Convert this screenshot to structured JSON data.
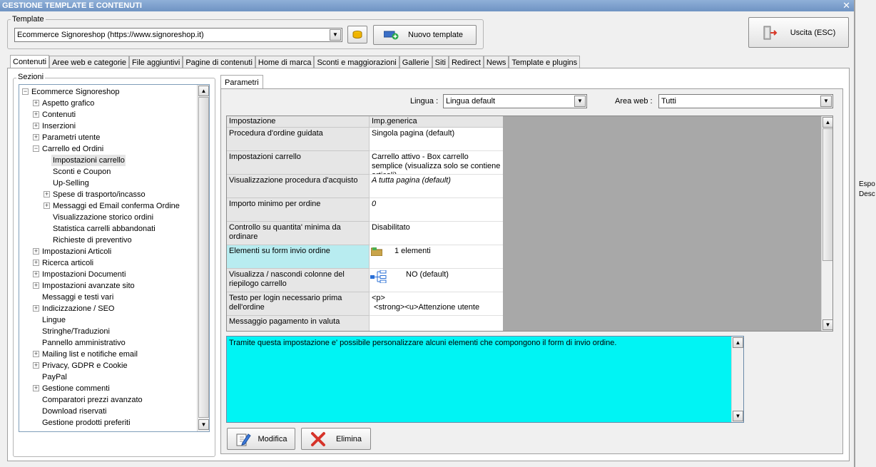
{
  "window": {
    "title": "GESTIONE TEMPLATE E CONTENUTI",
    "close_glyph": "✕"
  },
  "outside_text": {
    "line1": "Espo",
    "line2": "Desc"
  },
  "template": {
    "group_label": "Template",
    "selected": "Ecommerce Signoreshop (https://www.signoreshop.it)",
    "new_button": "Nuovo template"
  },
  "exit_button": "Uscita (ESC)",
  "tabs": [
    "Contenuti",
    "Aree web e categorie",
    "File aggiuntivi",
    "Pagine di contenuti",
    "Home di marca",
    "Sconti e maggiorazioni",
    "Gallerie",
    "Siti",
    "Redirect",
    "News",
    "Template e plugins"
  ],
  "sections": {
    "label": "Sezioni",
    "items": [
      {
        "label": "Ecommerce Signoreshop",
        "expander": "−"
      },
      {
        "label": "Aspetto grafico",
        "expander": "+"
      },
      {
        "label": "Contenuti",
        "expander": "+"
      },
      {
        "label": "Inserzioni",
        "expander": "+"
      },
      {
        "label": "Parametri utente",
        "expander": "+"
      },
      {
        "label": "Carrello ed Ordini",
        "expander": "−"
      },
      {
        "label": "Impostazioni carrello",
        "expander": ""
      },
      {
        "label": "Sconti e Coupon",
        "expander": ""
      },
      {
        "label": "Up-Selling",
        "expander": ""
      },
      {
        "label": "Spese di trasporto/incasso",
        "expander": "+"
      },
      {
        "label": "Messaggi ed Email conferma Ordine",
        "expander": "+"
      },
      {
        "label": "Visualizzazione storico ordini",
        "expander": ""
      },
      {
        "label": "Statistica carrelli abbandonati",
        "expander": ""
      },
      {
        "label": "Richieste di preventivo",
        "expander": ""
      },
      {
        "label": "Impostazioni Articoli",
        "expander": "+"
      },
      {
        "label": "Ricerca articoli",
        "expander": "+"
      },
      {
        "label": "Impostazioni Documenti",
        "expander": "+"
      },
      {
        "label": "Impostazioni avanzate sito",
        "expander": "+"
      },
      {
        "label": "Messaggi e testi vari",
        "expander": ""
      },
      {
        "label": "Indicizzazione / SEO",
        "expander": "+"
      },
      {
        "label": "Lingue",
        "expander": ""
      },
      {
        "label": "Stringhe/Traduzioni",
        "expander": ""
      },
      {
        "label": "Pannello amministrativo",
        "expander": ""
      },
      {
        "label": "Mailing list e notifiche email",
        "expander": "+"
      },
      {
        "label": "Privacy, GDPR e Cookie",
        "expander": "+"
      },
      {
        "label": "PayPal",
        "expander": ""
      },
      {
        "label": "Gestione commenti",
        "expander": "+"
      },
      {
        "label": "Comparatori prezzi avanzato",
        "expander": ""
      },
      {
        "label": "Download riservati",
        "expander": ""
      },
      {
        "label": "Gestione prodotti preferiti",
        "expander": ""
      }
    ]
  },
  "params": {
    "tab_label": "Parametri",
    "lingua_label": "Lingua :",
    "lingua_value": "Lingua default",
    "area_label": "Area web :",
    "area_value": "Tutti",
    "col_setting": "Impostazione",
    "col_value": "Imp.generica",
    "rows": [
      {
        "name": "Procedura d'ordine guidata",
        "value": "Singola pagina (default)"
      },
      {
        "name": "Impostazioni carrello",
        "value": "Carrello attivo - Box carrello semplice (visualizza solo se contiene articoli)"
      },
      {
        "name": "Visualizzazione procedura d'acquisto",
        "value": "A tutta pagina (default)"
      },
      {
        "name": "Importo minimo per ordine",
        "value": "0"
      },
      {
        "name": "Controllo su quantita' minima da ordinare",
        "value": "Disabilitato"
      },
      {
        "name": "Elementi su form invio ordine",
        "value": "1 elementi"
      },
      {
        "name": "Visualizza / nascondi colonne del riepilogo carrello",
        "value": "NO (default)"
      },
      {
        "name": "Testo per login necessario prima dell'ordine",
        "value": "<p>\n <strong><u>Attenzione utente"
      },
      {
        "name": "Messaggio pagamento in valuta",
        "value": ""
      }
    ],
    "description": "Tramite questa impostazione e' possibile personalizzare alcuni elementi che compongono il form di invio ordine.",
    "modify_button": "Modifica",
    "delete_button": "Elimina"
  }
}
